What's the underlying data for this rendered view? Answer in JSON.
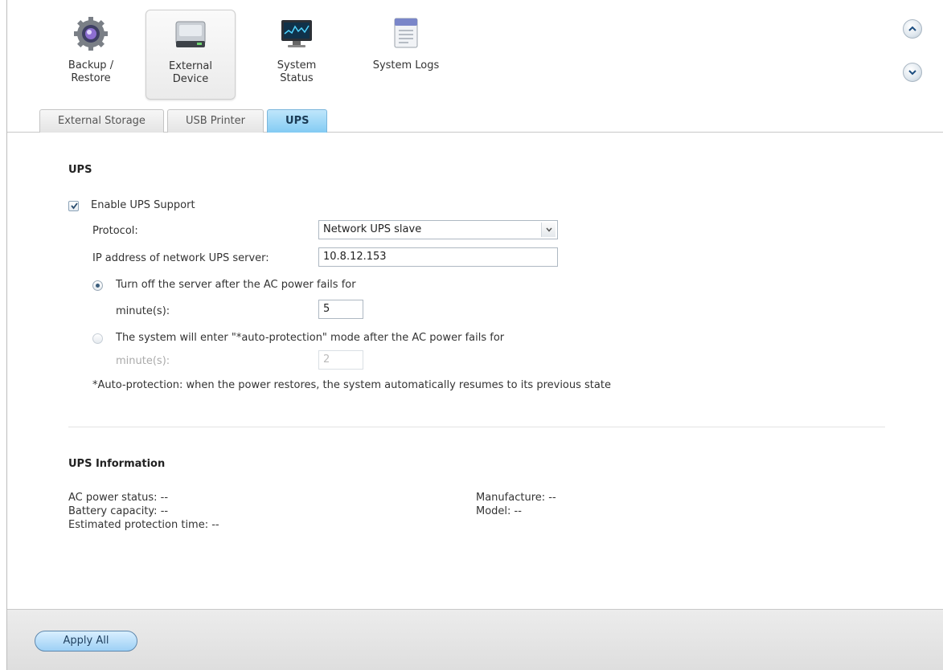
{
  "toolbar": {
    "tools": [
      {
        "label": "Backup /\nRestore",
        "icon": "gear-icon"
      },
      {
        "label": "External\nDevice",
        "icon": "drive-icon"
      },
      {
        "label": "System\nStatus",
        "icon": "monitor-icon"
      },
      {
        "label": "System Logs",
        "icon": "log-icon"
      }
    ],
    "active_tool": "External Device",
    "scroll_up_icon": "chevron-up-icon",
    "scroll_down_icon": "chevron-down-icon"
  },
  "tabs": [
    "External Storage",
    "USB Printer",
    "UPS"
  ],
  "active_tab": "UPS",
  "ups": {
    "heading": "UPS",
    "enable_label": "Enable UPS Support",
    "enable_checked": true,
    "protocol_label": "Protocol:",
    "protocol_value": "Network UPS slave",
    "ip_label": "IP address of network UPS server:",
    "ip_value": "10.8.12.153",
    "option1_label": "Turn off the server after the AC power fails for",
    "option1_unit": "minute(s):",
    "option1_value": "5",
    "option1_selected": true,
    "option2_label": "The system will enter \"*auto-protection\" mode after the AC power fails for",
    "option2_unit": "minute(s):",
    "option2_value": "2",
    "option2_selected": false,
    "note": "*Auto-protection: when the power restores, the system automatically resumes to its previous state"
  },
  "info": {
    "heading": "UPS Information",
    "ac_power_status": "AC power status:  --",
    "battery_capacity": "Battery capacity:  --",
    "estimated_time": "Estimated protection time:  --",
    "manufacture": "Manufacture:  --",
    "model": "Model:  --"
  },
  "footer": {
    "apply_label": "Apply All"
  },
  "colors": {
    "active_tab": "#83cbf3",
    "apply_button": "#9dd0f5",
    "radio_dot": "#3b5d7c"
  }
}
